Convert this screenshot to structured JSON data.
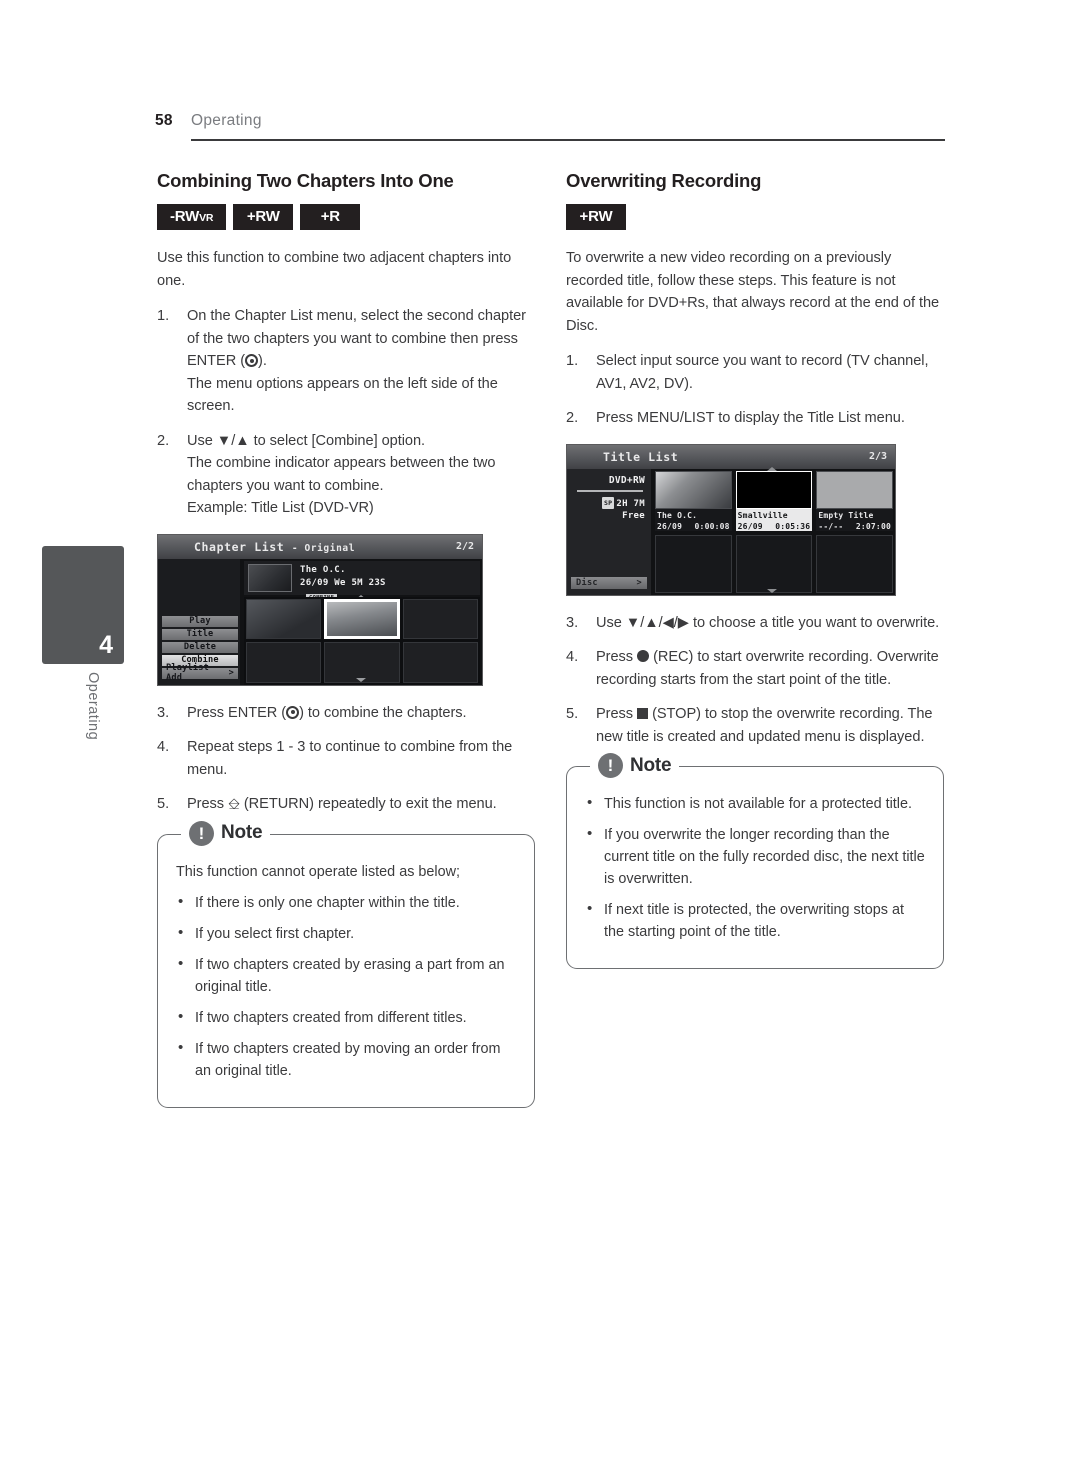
{
  "header": {
    "page_number": "58",
    "section": "Operating"
  },
  "side_tab": {
    "chapter_number": "4",
    "label": "Operating"
  },
  "left_column": {
    "title": "Combining Two Chapters Into One",
    "badges": [
      {
        "main": "-RW",
        "sub": "VR"
      },
      {
        "main": "+RW",
        "sub": ""
      },
      {
        "main": "+R",
        "sub": ""
      }
    ],
    "intro": "Use this function to combine two adjacent chapters into one.",
    "steps": [
      {
        "num": "1.",
        "text_a": "On the Chapter List menu, select the second chapter of the two chapters you want to combine then press ENTER (",
        "text_b": ").",
        "text_c": "The menu options appears on the left side of the screen."
      },
      {
        "num": "2.",
        "text_a": "Use ▼/▲ to select [Combine] option.",
        "text_b": "The combine indicator appears between the two chapters you want to combine.",
        "text_c": "Example: Title List (DVD-VR)"
      },
      {
        "num": "3.",
        "text_a": "Press ENTER (",
        "text_b": ") to combine the chapters."
      },
      {
        "num": "4.",
        "text_a": "Repeat steps 1 - 3 to continue to combine from the menu."
      },
      {
        "num": "5.",
        "text_a": "Press ",
        "return_glyph": "⌁",
        "text_b": " (RETURN) repeatedly to exit the menu."
      }
    ],
    "note": {
      "title": "Note",
      "icon": "!",
      "lead": "This function cannot operate listed as below;",
      "bullets": [
        "If there is only one chapter within the title.",
        "If you select first chapter.",
        "If two chapters created by erasing a part from an original title.",
        "If two chapters created from different titles.",
        "If two chapters created by moving an order from an original title."
      ]
    }
  },
  "right_column": {
    "title": "Overwriting Recording",
    "badges": [
      {
        "main": "+RW",
        "sub": ""
      }
    ],
    "intro": "To overwrite a new video recording on a previously recorded title, follow these steps. This feature is not available for DVD+Rs, that always record at the end of the Disc.",
    "steps": [
      {
        "num": "1.",
        "text_a": "Select input source you want to record (TV channel, AV1, AV2, DV)."
      },
      {
        "num": "2.",
        "text_a": "Press MENU/LIST to display the Title List menu."
      },
      {
        "num": "3.",
        "text_a": "Use ▼/▲/◀/▶ to choose a title you want to overwrite."
      },
      {
        "num": "4.",
        "text_a": "Press ",
        "text_b": " (REC) to start overwrite recording. Overwrite recording starts from the start point of the title."
      },
      {
        "num": "5.",
        "text_a": "Press ",
        "text_b": " (STOP) to stop the overwrite recording. The new title is created and updated menu is displayed."
      }
    ],
    "note": {
      "title": "Note",
      "icon": "!",
      "bullets": [
        "This function is not available for a protected title.",
        "If you overwrite the longer recording than the current title on the fully recorded disc, the next title is overwritten.",
        "If next title is protected, the overwriting stops at the starting point of the title."
      ]
    }
  },
  "chapter_list_screenshot": {
    "title": "Chapter List",
    "title_suffix": "- Original",
    "page_indicator": "2/2",
    "info_title": "The O.C.",
    "info_meta": "26/09 We   5M 23S",
    "combine_tag": "COMBINE",
    "menu_items": [
      {
        "label": "Play",
        "selected": false,
        "arrow": false
      },
      {
        "label": "Title",
        "selected": false,
        "arrow": false
      },
      {
        "label": "Delete",
        "selected": false,
        "arrow": false
      },
      {
        "label": "Combine",
        "selected": true,
        "arrow": false
      },
      {
        "label": "Playlist Add",
        "selected": false,
        "arrow": true,
        "arrow_glyph": ">"
      }
    ]
  },
  "title_list_screenshot": {
    "title": "Title List",
    "page_indicator": "2/3",
    "disc_type": "DVD+RW",
    "sp_icon": "SP",
    "free_line1": "2H 7M",
    "free_line2": "Free",
    "disc_button": "Disc",
    "disc_button_arrow": ">",
    "titles": [
      {
        "name": "The O.C.",
        "date": "26/09",
        "time": "0:00:08",
        "selected": false,
        "pic": "photo"
      },
      {
        "name": "Smallville",
        "date": "26/09",
        "time": "0:05:36",
        "selected": true,
        "pic": "black"
      },
      {
        "name": "Empty Title",
        "date": "--/--",
        "time": "2:07:00",
        "selected": false,
        "pic": "empty"
      }
    ]
  }
}
